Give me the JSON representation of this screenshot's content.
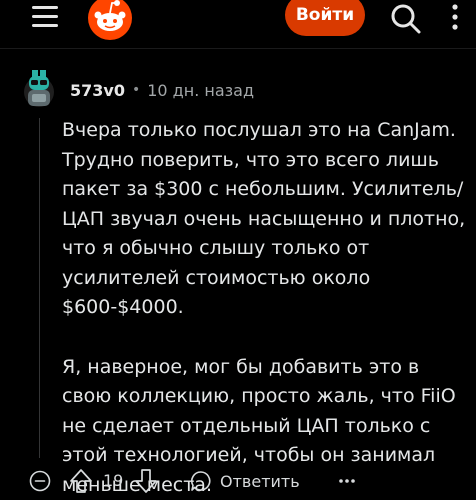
{
  "header": {
    "menu_icon": "hamburger-menu-icon",
    "logo_icon": "reddit-snoo-logo",
    "login_label": "Войти",
    "search_icon": "search-icon",
    "more_icon": "vertical-ellipsis-icon"
  },
  "comment": {
    "author": "573v0",
    "separator": "•",
    "timestamp": "10 дн. назад",
    "paragraphs": [
      "Вчера только послушал это на CanJam. Трудно поверить, что это всего лишь пакет за $300 с небольшим. Усилитель/ЦАП звучал очень насыщенно и плотно, что я обычно слышу только от усилителей стоимостью около $600-$4000.",
      "Я, наверное, мог бы добавить это в свою коллекцию, просто жаль, что FiiO не сделает отдельный ЦАП только с этой технологией, чтобы он занимал меньше места."
    ]
  },
  "actions": {
    "score": "19",
    "reply_label": "Ответить",
    "collapse_icon": "collapse-minus-icon",
    "upvote_icon": "upvote-arrow-icon",
    "downvote_icon": "downvote-arrow-icon",
    "reply_icon": "speech-bubble-icon",
    "overflow_icon": "horizontal-ellipsis-icon"
  },
  "colors": {
    "background": "#000000",
    "accent": "#d93a00",
    "text": "#e4e6e7",
    "muted": "#a3a7a9"
  }
}
